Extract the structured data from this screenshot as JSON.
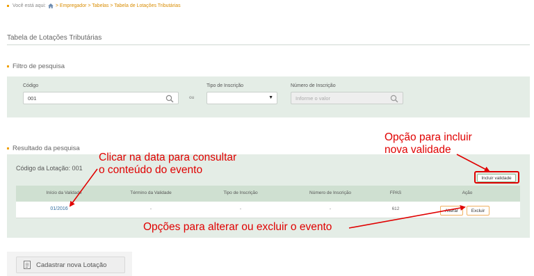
{
  "breadcrumb": {
    "prefix": "Você está aqui:",
    "path": "> Empregador > Tabelas > Tabela de Lotações Tributárias"
  },
  "page_title": "Tabela de Lotações Tributárias",
  "filter": {
    "title": "Filtro de pesquisa",
    "codigo_label": "Código",
    "codigo_value": "001",
    "ou_label": "ou",
    "tipo_label": "Tipo de Inscrição",
    "tipo_value": "",
    "numero_label": "Número de Inscrição",
    "numero_placeholder": "Informe o valor"
  },
  "result": {
    "title": "Resultado da pesquisa",
    "code_label": "Código da Lotação: 001",
    "incluir_label": "Incluir validade",
    "columns": [
      "Início da Validade",
      "Término da Validade",
      "Tipo de Inscrição",
      "Número de Inscrição",
      "FPAS",
      "Ação"
    ],
    "row": {
      "inicio": "01/2016",
      "termino": "-",
      "tipo": "-",
      "numero": "-",
      "fpas": "612"
    },
    "alterar_label": "Alterar",
    "excluir_label": "Excluir"
  },
  "cadastrar_label": "Cadastrar nova Lotação",
  "annotations": {
    "incluir_line1": "Opção para incluir",
    "incluir_line2": "nova validade",
    "data_line1": "Clicar na data para consultar",
    "data_line2": "o conteúdo do evento",
    "opcoes": "Opções para alterar ou excluir o evento"
  },
  "colors": {
    "accent": "#f0a000",
    "annotation": "#e00000",
    "panel": "#e4ede6",
    "table_header": "#cfe0d1"
  }
}
